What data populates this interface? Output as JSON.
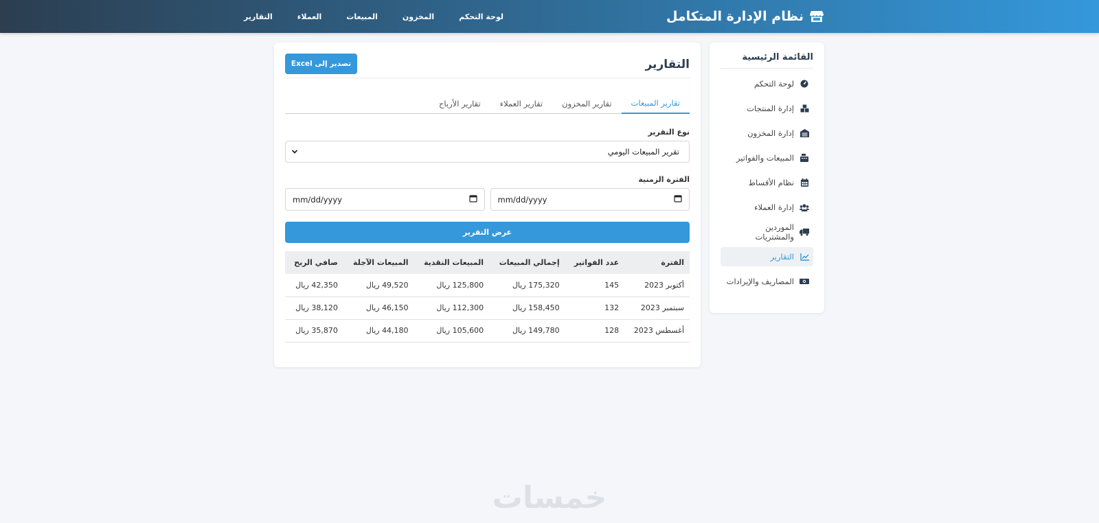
{
  "app": {
    "title": "نظام الإدارة المتكامل",
    "logo_icon": "store-icon"
  },
  "topnav": {
    "items": [
      "لوحة التحكم",
      "المخزون",
      "المبيعات",
      "العملاء",
      "التقارير"
    ]
  },
  "sidebar": {
    "title": "القائمة الرئيسية",
    "items": [
      {
        "label": "لوحة التحكم",
        "icon": "dashboard-icon"
      },
      {
        "label": "إدارة المنتجات",
        "icon": "boxes-icon"
      },
      {
        "label": "إدارة المخزون",
        "icon": "warehouse-icon"
      },
      {
        "label": "المبيعات والفواتير",
        "icon": "cash-register-icon"
      },
      {
        "label": "نظام الأقساط",
        "icon": "calendar-icon"
      },
      {
        "label": "إدارة العملاء",
        "icon": "users-icon"
      },
      {
        "label": "الموردين والمشتريات",
        "icon": "truck-icon"
      },
      {
        "label": "التقارير",
        "icon": "chart-line-icon",
        "active": true
      },
      {
        "label": "المصاريف والإيرادات",
        "icon": "money-icon"
      }
    ]
  },
  "main": {
    "title": "التقارير",
    "export_label": "تصدير إلى Excel",
    "tabs": [
      "تقارير المبيعات",
      "تقارير المخزون",
      "تقارير العملاء",
      "تقارير الأرباح"
    ],
    "active_tab": 0,
    "report_type_label": "نوع التقرير",
    "report_type_value": "تقرير المبيعات اليومي",
    "period_label": "الفترة الزمنية",
    "date_from_placeholder": "mm/dd/yyyy",
    "date_to_placeholder": "mm/dd/yyyy",
    "submit_label": "عرض التقرير",
    "table": {
      "headers": [
        "الفترة",
        "عدد الفواتير",
        "إجمالي المبيعات",
        "المبيعات النقدية",
        "المبيعات الآجلة",
        "صافي الربح"
      ],
      "rows": [
        [
          "أكتوبر 2023",
          "145",
          "175,320 ريال",
          "125,800 ريال",
          "49,520 ريال",
          "42,350 ريال"
        ],
        [
          "سبتمبر 2023",
          "132",
          "158,450 ريال",
          "112,300 ريال",
          "46,150 ريال",
          "38,120 ريال"
        ],
        [
          "أغسطس 2023",
          "128",
          "149,780 ريال",
          "105,600 ريال",
          "44,180 ريال",
          "35,870 ريال"
        ]
      ]
    }
  },
  "watermark": "خمسات",
  "colors": {
    "accent": "#3498db",
    "header_dark": "#2c3e50",
    "background": "#f4f6fa"
  }
}
